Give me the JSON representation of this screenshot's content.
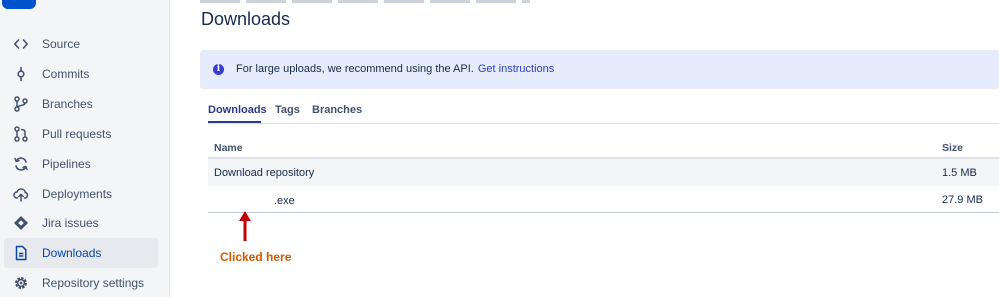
{
  "sidebar": {
    "items": [
      {
        "label": "Source",
        "icon": "code-icon"
      },
      {
        "label": "Commits",
        "icon": "commit-icon"
      },
      {
        "label": "Branches",
        "icon": "branch-icon"
      },
      {
        "label": "Pull requests",
        "icon": "pull-request-icon"
      },
      {
        "label": "Pipelines",
        "icon": "pipelines-icon"
      },
      {
        "label": "Deployments",
        "icon": "cloud-upload-icon"
      },
      {
        "label": "Jira issues",
        "icon": "jira-icon"
      },
      {
        "label": "Downloads",
        "icon": "file-icon",
        "active": true
      },
      {
        "label": "Repository settings",
        "icon": "gear-icon"
      }
    ]
  },
  "page": {
    "title": "Downloads"
  },
  "banner": {
    "icon": "info-icon",
    "text": "For large uploads, we recommend using the API.",
    "link": "Get instructions"
  },
  "tabs": [
    {
      "label": "Downloads",
      "active": true
    },
    {
      "label": "Tags"
    },
    {
      "label": "Branches"
    }
  ],
  "table": {
    "headers": {
      "name": "Name",
      "size": "Size"
    },
    "rows": [
      {
        "name": "Download repository",
        "size": "1.5 MB"
      },
      {
        "name": ".exe",
        "size": "27.9 MB"
      }
    ]
  },
  "annotation": {
    "text": "Clicked here",
    "color": "#d05a00"
  },
  "colors": {
    "accent": "#2b3a8c",
    "banner_bg": "#e6ecfb",
    "sidebar_bg": "#f4f5f7"
  }
}
